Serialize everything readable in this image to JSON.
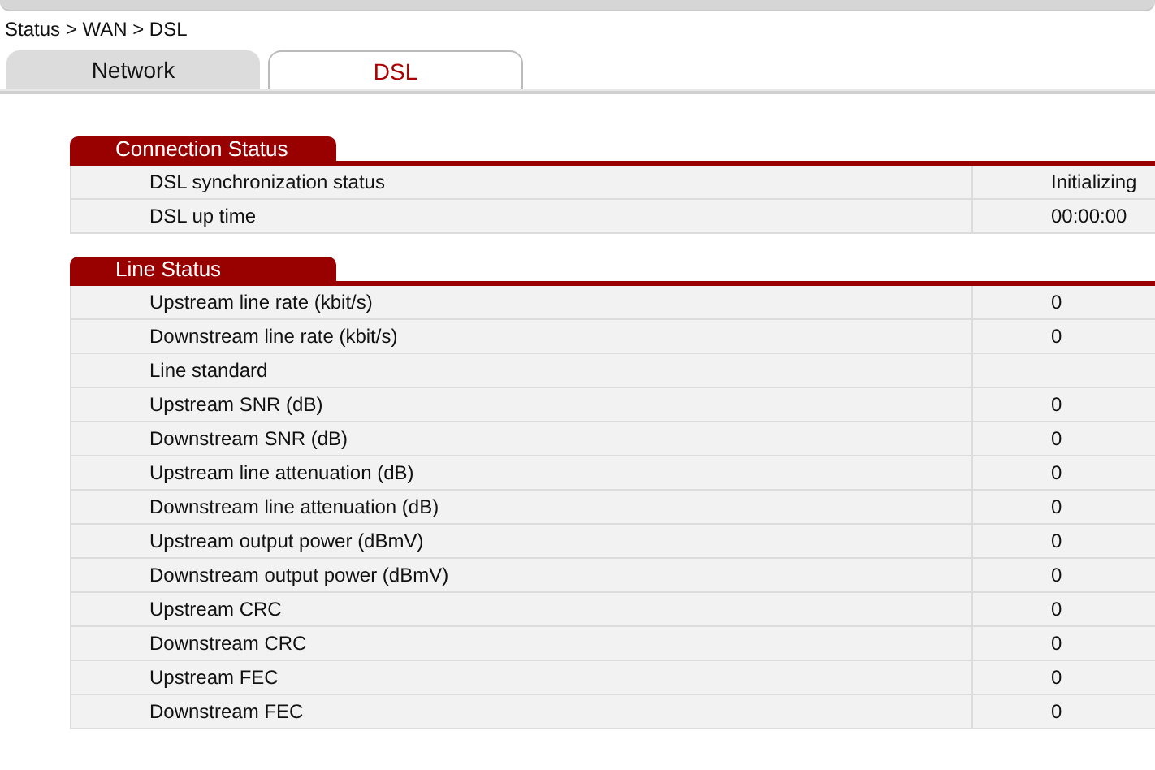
{
  "breadcrumb": "Status > WAN > DSL",
  "tabs": [
    {
      "label": "Network",
      "selected": false
    },
    {
      "label": "DSL",
      "selected": true
    }
  ],
  "sections": [
    {
      "title": "Connection Status",
      "rows": [
        {
          "label": "DSL synchronization status",
          "value": "Initializing"
        },
        {
          "label": "DSL up time",
          "value": "00:00:00"
        }
      ]
    },
    {
      "title": "Line Status",
      "rows": [
        {
          "label": "Upstream line rate (kbit/s)",
          "value": "0"
        },
        {
          "label": "Downstream line rate (kbit/s)",
          "value": "0"
        },
        {
          "label": "Line standard"
        },
        {
          "label": "Upstream SNR (dB)",
          "value": "0"
        },
        {
          "label": "Downstream SNR (dB)",
          "value": "0"
        },
        {
          "label": "Upstream line attenuation (dB)",
          "value": "0"
        },
        {
          "label": "Downstream line attenuation (dB)",
          "value": "0"
        },
        {
          "label": "Upstream output power (dBmV)",
          "value": "0"
        },
        {
          "label": "Downstream output power (dBmV)",
          "value": "0"
        },
        {
          "label": "Upstream CRC",
          "value": "0"
        },
        {
          "label": "Downstream CRC",
          "value": "0"
        },
        {
          "label": "Upstream FEC",
          "value": "0"
        },
        {
          "label": "Downstream FEC",
          "value": "0"
        }
      ]
    }
  ]
}
